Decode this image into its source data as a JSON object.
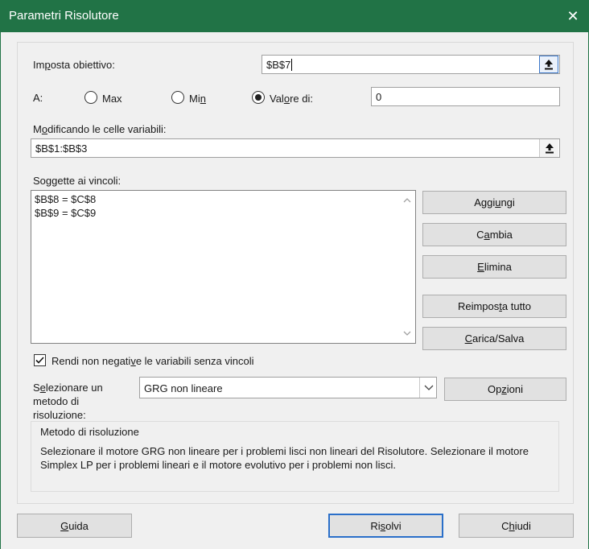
{
  "window": {
    "title": "Parametri Risolutore",
    "close_glyph": "✕"
  },
  "objective": {
    "label_pre": "Im",
    "label_acc": "p",
    "label_post": "osta obiettivo:",
    "value": "$B$7"
  },
  "to": {
    "label": "A:",
    "max_label": "Max",
    "min_label_pre": "Mi",
    "min_label_acc": "n",
    "value_label_pre": "Val",
    "value_label_acc": "o",
    "value_label_post": "re di:",
    "selected": "Valore di:",
    "value": "0"
  },
  "variables": {
    "label_pre": "M",
    "label_acc": "o",
    "label_post": "dificando le celle variabili:",
    "value": "$B$1:$B$3"
  },
  "constraints": {
    "label": "Soggette ai vincoli:",
    "items": [
      "$B$8 = $C$8",
      "$B$9 = $C$9"
    ]
  },
  "buttons": {
    "add_pre": "Aggi",
    "add_acc": "u",
    "add_post": "ngi",
    "change_pre": "C",
    "change_acc": "a",
    "change_post": "mbia",
    "delete_acc": "E",
    "delete_post": "limina",
    "reset_pre": "Reimpos",
    "reset_acc": "t",
    "reset_post": "a tutto",
    "loadsave_acc": "C",
    "loadsave_post": "arica/Salva",
    "options_pre": "Op",
    "options_acc": "z",
    "options_post": "ioni",
    "help_acc": "G",
    "help_post": "uida",
    "solve_pre": "Ri",
    "solve_acc": "s",
    "solve_post": "olvi",
    "close_pre": "C",
    "close_acc": "h",
    "close_post": "iudi"
  },
  "nonneg": {
    "label_pre": "Rendi non negati",
    "label_acc": "v",
    "label_post": "e le variabili senza vincoli",
    "checked": true
  },
  "method": {
    "label_line1_pre": "S",
    "label_line1_acc": "e",
    "label_line1_post": "lezionare un",
    "label_line2": "metodo di",
    "label_line3": "risoluzione:",
    "selected": "GRG non lineare"
  },
  "method_group": {
    "title": "Metodo di risoluzione",
    "description_line1": "Selezionare il motore GRG non lineare per i problemi lisci non lineari del Risolutore. Selezionare il motore",
    "description_line2": "Simplex LP per i problemi lineari e il motore evolutivo per i problemi non lisci."
  },
  "icons": {
    "ref_collapse": "collapse-arrow-up-icon",
    "scroll_up": "chevron-up-icon",
    "scroll_down": "chevron-down-icon",
    "combo_dropdown": "chevron-down-icon",
    "checkmark": "checkmark-icon"
  },
  "colors": {
    "titlebar": "#217346",
    "dialog_bg": "#f0f0f0",
    "primary_border": "#2a6fc9"
  }
}
